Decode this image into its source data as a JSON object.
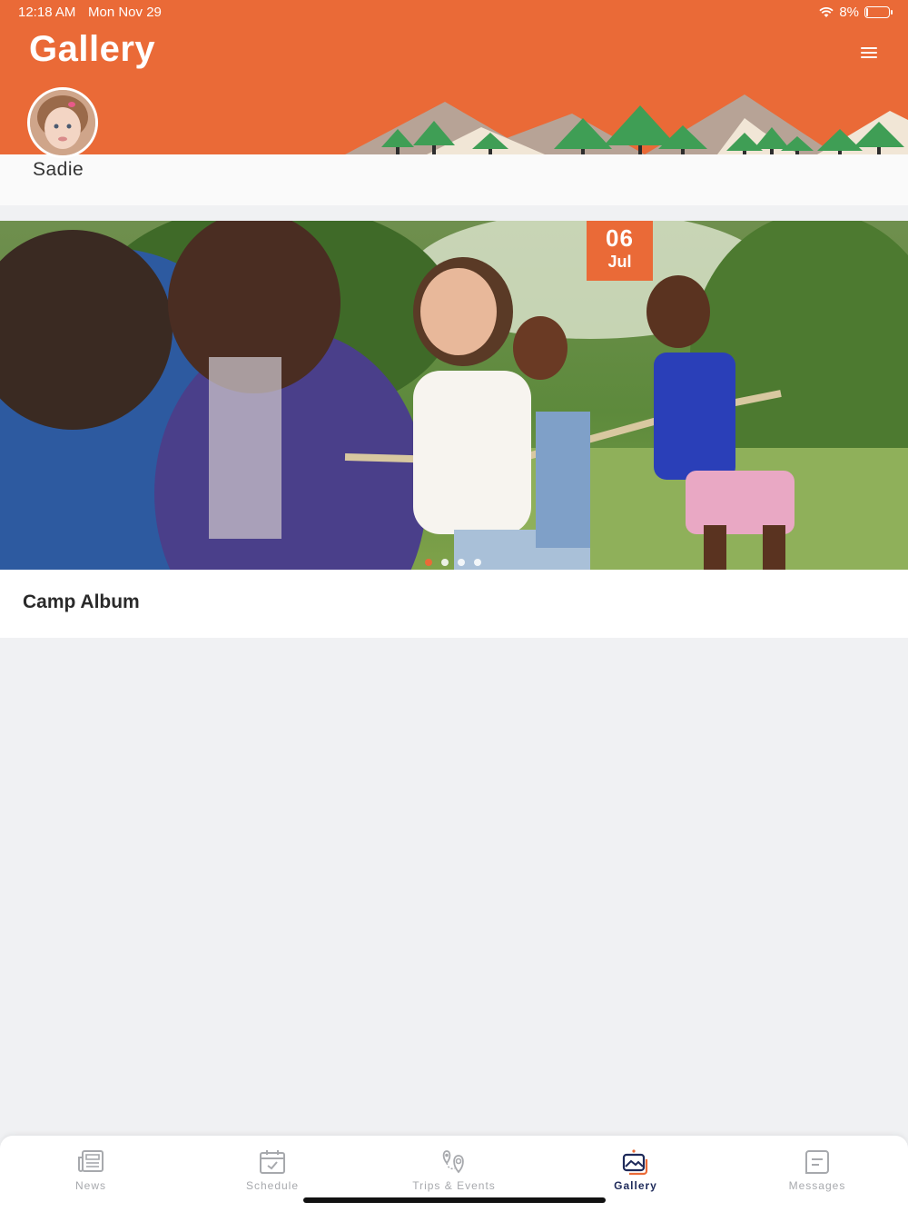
{
  "status_bar": {
    "time": "12:18 AM",
    "date": "Mon Nov 29",
    "battery": "8%",
    "battery_level": 0.08
  },
  "header": {
    "title": "Gallery",
    "menu_icon": "hamburger-icon"
  },
  "profile": {
    "name": "Sadie"
  },
  "album": {
    "title": "Camp Album",
    "date_day": "06",
    "date_month": "Jul",
    "page_count": 4,
    "active_page": 1
  },
  "tabs": [
    {
      "label": "News",
      "icon": "news-icon",
      "active": false
    },
    {
      "label": "Schedule",
      "icon": "calendar-icon",
      "active": false
    },
    {
      "label": "Trips & Events",
      "icon": "map-pin-icon",
      "active": false
    },
    {
      "label": "Gallery",
      "icon": "gallery-icon",
      "active": true
    },
    {
      "label": "Messages",
      "icon": "message-icon",
      "active": false
    }
  ],
  "colors": {
    "accent": "#ea6a37",
    "active_tab": "#1e2a5a",
    "inactive_tab": "#a7a9ad"
  }
}
